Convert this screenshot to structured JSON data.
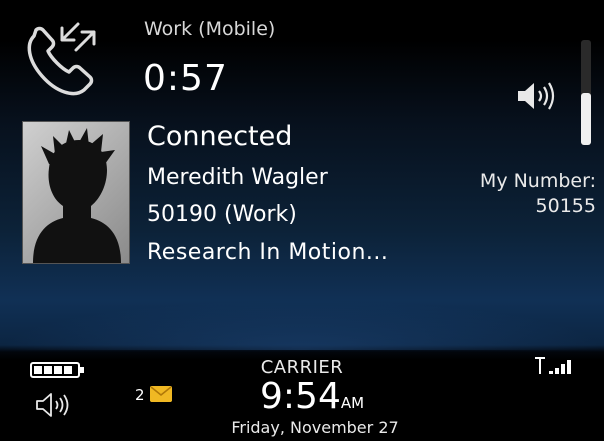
{
  "call": {
    "type_label": "Work (Mobile)",
    "duration": "0:57",
    "status": "Connected",
    "contact_name": "Meredith Wagler",
    "contact_number": "50190 (Work)",
    "company": "Research In Motion...",
    "my_number_label": "My Number:",
    "my_number": "50155",
    "volume_level": 0.5
  },
  "status_bar": {
    "carrier": "CARRIER",
    "time": "9:54",
    "ampm": "AM",
    "date": "Friday, November 27",
    "unread_messages": "2",
    "battery_level": 1.0,
    "signal_bars": 4
  },
  "icons": [
    "call-transfer-icon",
    "speaker-icon",
    "contact-avatar",
    "battery-icon",
    "sound-profile-icon",
    "envelope-icon",
    "signal-icon"
  ],
  "colors": {
    "envelope": "#f0b823",
    "background_blue": "#103055"
  }
}
